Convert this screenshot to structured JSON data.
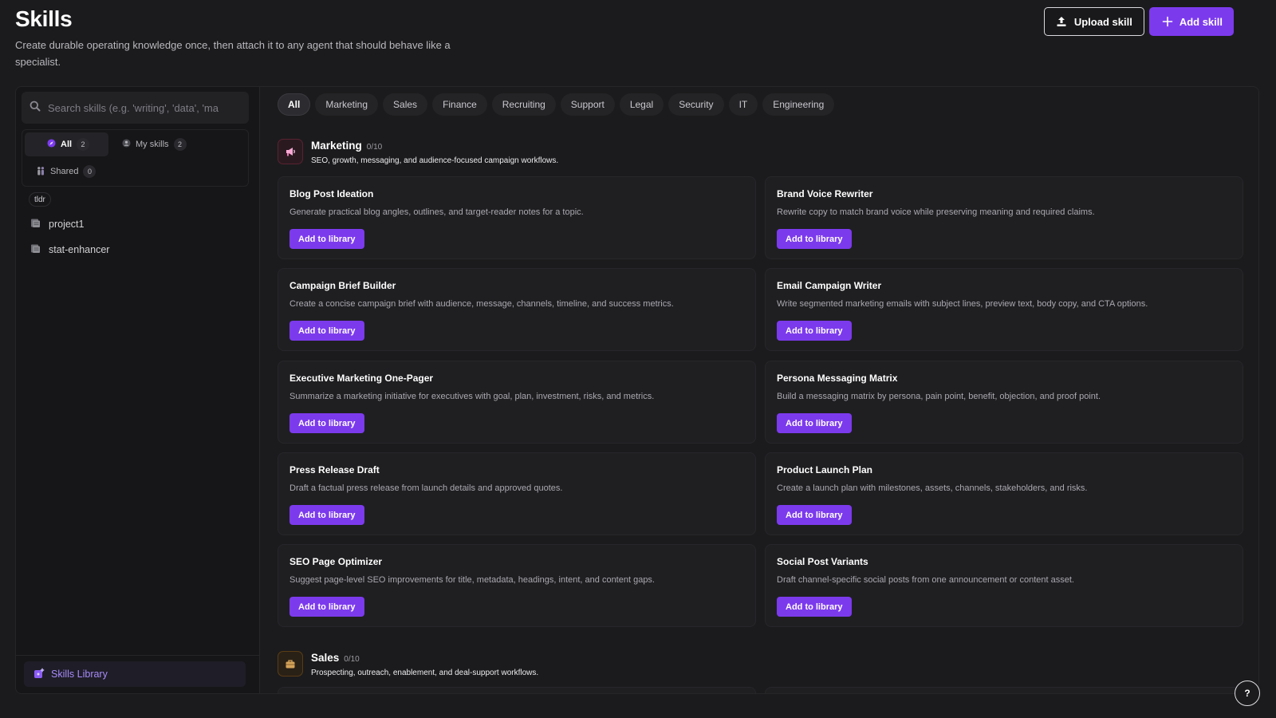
{
  "header": {
    "title": "Skills",
    "subtitle": "Create durable operating knowledge once, then attach it to any agent that should behave like a specialist.",
    "upload_label": "Upload skill",
    "add_label": "Add skill"
  },
  "sidebar": {
    "search_placeholder": "Search skills (e.g. 'writing', 'data', 'ma",
    "filters": [
      {
        "label": "All",
        "count": "2",
        "icon": "compass-icon",
        "active": true
      },
      {
        "label": "My skills",
        "count": "2",
        "icon": "user-icon",
        "active": false
      },
      {
        "label": "Shared",
        "count": "0",
        "icon": "people-icon",
        "active": false
      }
    ],
    "tag": "tldr",
    "projects": [
      {
        "label": "project1",
        "icon": "scroll-icon"
      },
      {
        "label": "stat-enhancer",
        "icon": "scroll-icon"
      }
    ],
    "library_label": "Skills Library"
  },
  "categories": [
    "All",
    "Marketing",
    "Sales",
    "Finance",
    "Recruiting",
    "Support",
    "Legal",
    "Security",
    "IT",
    "Engineering"
  ],
  "sections": [
    {
      "title": "Marketing",
      "count": "0/10",
      "description": "SEO, growth, messaging, and audience-focused campaign workflows.",
      "icon": "megaphone-icon",
      "accent": "#e11d48",
      "skills": [
        {
          "title": "Blog Post Ideation",
          "desc": "Generate practical blog angles, outlines, and target-reader notes for a topic.",
          "button": "Add to library"
        },
        {
          "title": "Brand Voice Rewriter",
          "desc": "Rewrite copy to match brand voice while preserving meaning and required claims.",
          "button": "Add to library"
        },
        {
          "title": "Campaign Brief Builder",
          "desc": "Create a concise campaign brief with audience, message, channels, timeline, and success metrics.",
          "button": "Add to library"
        },
        {
          "title": "Email Campaign Writer",
          "desc": "Write segmented marketing emails with subject lines, preview text, body copy, and CTA options.",
          "button": "Add to library"
        },
        {
          "title": "Executive Marketing One-Pager",
          "desc": "Summarize a marketing initiative for executives with goal, plan, investment, risks, and metrics.",
          "button": "Add to library"
        },
        {
          "title": "Persona Messaging Matrix",
          "desc": "Build a messaging matrix by persona, pain point, benefit, objection, and proof point.",
          "button": "Add to library"
        },
        {
          "title": "Press Release Draft",
          "desc": "Draft a factual press release from launch details and approved quotes.",
          "button": "Add to library"
        },
        {
          "title": "Product Launch Plan",
          "desc": "Create a launch plan with milestones, assets, channels, stakeholders, and risks.",
          "button": "Add to library"
        },
        {
          "title": "SEO Page Optimizer",
          "desc": "Suggest page-level SEO improvements for title, metadata, headings, intent, and content gaps.",
          "button": "Add to library"
        },
        {
          "title": "Social Post Variants",
          "desc": "Draft channel-specific social posts from one announcement or content asset.",
          "button": "Add to library"
        }
      ]
    },
    {
      "title": "Sales",
      "count": "0/10",
      "description": "Prospecting, outreach, enablement, and deal-support workflows.",
      "icon": "briefcase-icon",
      "accent": "#d97706"
    }
  ],
  "help_label": "?",
  "colors": {
    "accent": "#7c3aed",
    "background": "#1b1b1d",
    "card": "#1f1f22"
  }
}
